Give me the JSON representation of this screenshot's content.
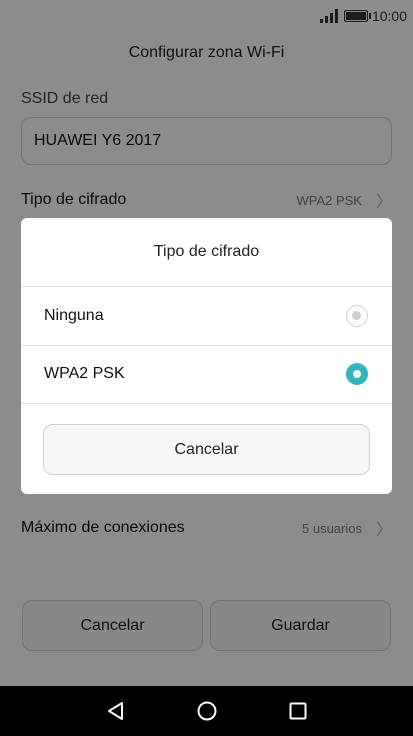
{
  "status_bar": {
    "time": "10:00"
  },
  "page": {
    "title": "Configurar zona Wi-Fi",
    "ssid_label": "SSID de red",
    "ssid_value": "HUAWEI Y6 2017",
    "encryption_label": "Tipo de cifrado",
    "encryption_value": "WPA2 PSK",
    "max_label": "Máximo de conexiones",
    "max_value": "5 usuarios",
    "cancel_label": "Cancelar",
    "save_label": "Guardar"
  },
  "dialog": {
    "title": "Tipo de cifrado",
    "options": [
      {
        "label": "Ninguna",
        "selected": false
      },
      {
        "label": "WPA2 PSK",
        "selected": true
      }
    ],
    "cancel_label": "Cancelar"
  },
  "colors": {
    "accent": "#33b5bf",
    "navbar": "#000000"
  },
  "icons": {
    "back": "triangle-back-icon",
    "home": "circle-home-icon",
    "recents": "square-recents-icon"
  }
}
